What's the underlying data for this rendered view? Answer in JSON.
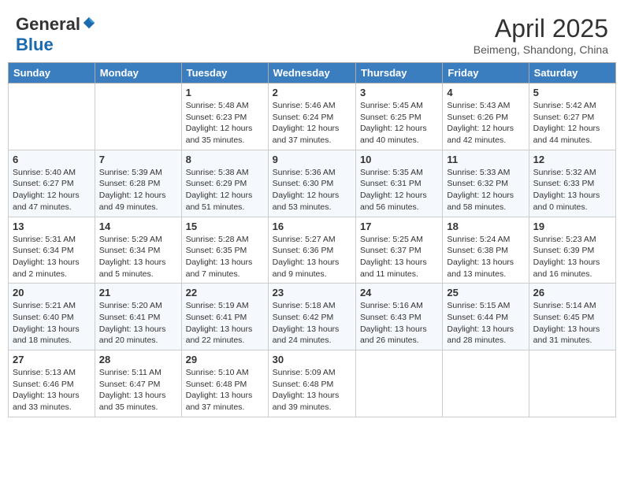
{
  "header": {
    "logo_general": "General",
    "logo_blue": "Blue",
    "month_title": "April 2025",
    "location": "Beimeng, Shandong, China"
  },
  "days_of_week": [
    "Sunday",
    "Monday",
    "Tuesday",
    "Wednesday",
    "Thursday",
    "Friday",
    "Saturday"
  ],
  "weeks": [
    [
      {
        "day": "",
        "info": ""
      },
      {
        "day": "",
        "info": ""
      },
      {
        "day": "1",
        "info": "Sunrise: 5:48 AM\nSunset: 6:23 PM\nDaylight: 12 hours\nand 35 minutes."
      },
      {
        "day": "2",
        "info": "Sunrise: 5:46 AM\nSunset: 6:24 PM\nDaylight: 12 hours\nand 37 minutes."
      },
      {
        "day": "3",
        "info": "Sunrise: 5:45 AM\nSunset: 6:25 PM\nDaylight: 12 hours\nand 40 minutes."
      },
      {
        "day": "4",
        "info": "Sunrise: 5:43 AM\nSunset: 6:26 PM\nDaylight: 12 hours\nand 42 minutes."
      },
      {
        "day": "5",
        "info": "Sunrise: 5:42 AM\nSunset: 6:27 PM\nDaylight: 12 hours\nand 44 minutes."
      }
    ],
    [
      {
        "day": "6",
        "info": "Sunrise: 5:40 AM\nSunset: 6:27 PM\nDaylight: 12 hours\nand 47 minutes."
      },
      {
        "day": "7",
        "info": "Sunrise: 5:39 AM\nSunset: 6:28 PM\nDaylight: 12 hours\nand 49 minutes."
      },
      {
        "day": "8",
        "info": "Sunrise: 5:38 AM\nSunset: 6:29 PM\nDaylight: 12 hours\nand 51 minutes."
      },
      {
        "day": "9",
        "info": "Sunrise: 5:36 AM\nSunset: 6:30 PM\nDaylight: 12 hours\nand 53 minutes."
      },
      {
        "day": "10",
        "info": "Sunrise: 5:35 AM\nSunset: 6:31 PM\nDaylight: 12 hours\nand 56 minutes."
      },
      {
        "day": "11",
        "info": "Sunrise: 5:33 AM\nSunset: 6:32 PM\nDaylight: 12 hours\nand 58 minutes."
      },
      {
        "day": "12",
        "info": "Sunrise: 5:32 AM\nSunset: 6:33 PM\nDaylight: 13 hours\nand 0 minutes."
      }
    ],
    [
      {
        "day": "13",
        "info": "Sunrise: 5:31 AM\nSunset: 6:34 PM\nDaylight: 13 hours\nand 2 minutes."
      },
      {
        "day": "14",
        "info": "Sunrise: 5:29 AM\nSunset: 6:34 PM\nDaylight: 13 hours\nand 5 minutes."
      },
      {
        "day": "15",
        "info": "Sunrise: 5:28 AM\nSunset: 6:35 PM\nDaylight: 13 hours\nand 7 minutes."
      },
      {
        "day": "16",
        "info": "Sunrise: 5:27 AM\nSunset: 6:36 PM\nDaylight: 13 hours\nand 9 minutes."
      },
      {
        "day": "17",
        "info": "Sunrise: 5:25 AM\nSunset: 6:37 PM\nDaylight: 13 hours\nand 11 minutes."
      },
      {
        "day": "18",
        "info": "Sunrise: 5:24 AM\nSunset: 6:38 PM\nDaylight: 13 hours\nand 13 minutes."
      },
      {
        "day": "19",
        "info": "Sunrise: 5:23 AM\nSunset: 6:39 PM\nDaylight: 13 hours\nand 16 minutes."
      }
    ],
    [
      {
        "day": "20",
        "info": "Sunrise: 5:21 AM\nSunset: 6:40 PM\nDaylight: 13 hours\nand 18 minutes."
      },
      {
        "day": "21",
        "info": "Sunrise: 5:20 AM\nSunset: 6:41 PM\nDaylight: 13 hours\nand 20 minutes."
      },
      {
        "day": "22",
        "info": "Sunrise: 5:19 AM\nSunset: 6:41 PM\nDaylight: 13 hours\nand 22 minutes."
      },
      {
        "day": "23",
        "info": "Sunrise: 5:18 AM\nSunset: 6:42 PM\nDaylight: 13 hours\nand 24 minutes."
      },
      {
        "day": "24",
        "info": "Sunrise: 5:16 AM\nSunset: 6:43 PM\nDaylight: 13 hours\nand 26 minutes."
      },
      {
        "day": "25",
        "info": "Sunrise: 5:15 AM\nSunset: 6:44 PM\nDaylight: 13 hours\nand 28 minutes."
      },
      {
        "day": "26",
        "info": "Sunrise: 5:14 AM\nSunset: 6:45 PM\nDaylight: 13 hours\nand 31 minutes."
      }
    ],
    [
      {
        "day": "27",
        "info": "Sunrise: 5:13 AM\nSunset: 6:46 PM\nDaylight: 13 hours\nand 33 minutes."
      },
      {
        "day": "28",
        "info": "Sunrise: 5:11 AM\nSunset: 6:47 PM\nDaylight: 13 hours\nand 35 minutes."
      },
      {
        "day": "29",
        "info": "Sunrise: 5:10 AM\nSunset: 6:48 PM\nDaylight: 13 hours\nand 37 minutes."
      },
      {
        "day": "30",
        "info": "Sunrise: 5:09 AM\nSunset: 6:48 PM\nDaylight: 13 hours\nand 39 minutes."
      },
      {
        "day": "",
        "info": ""
      },
      {
        "day": "",
        "info": ""
      },
      {
        "day": "",
        "info": ""
      }
    ]
  ]
}
